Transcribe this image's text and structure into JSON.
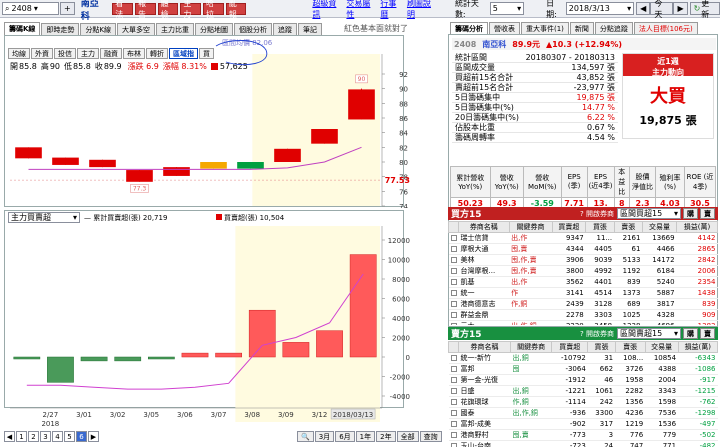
{
  "topbar": {
    "stock_code": "2408",
    "stock_name": "南亞科",
    "quick_buttons": [
      "看法",
      "報告",
      "體檢",
      "主力",
      "哈拉",
      "亂報"
    ],
    "links": [
      "超級資訊",
      "交易屬性",
      "行事曆",
      "刷圖說明"
    ],
    "days_label": "統計天數:",
    "days_value": "5",
    "date_label": "日期:",
    "date_value": "2018/3/13",
    "today_btn": "今天",
    "refresh_btn": "更新"
  },
  "main_tabs": [
    "籌碼K線",
    "即時走勢",
    "分點K線",
    "大單多空",
    "主力比重",
    "分點地圖",
    "個股分析",
    "追蹤",
    "筆記"
  ],
  "main_tab_active": 0,
  "slogan": "紅色基本面就對了",
  "sub_tabs": [
    "均線",
    "外資",
    "投信",
    "主力",
    "融資",
    "布林",
    "轉折",
    "區域指",
    "買"
  ],
  "sub_tab_active": 7,
  "annotation_text": "區間均價 82.06",
  "pricebar": {
    "open_label": "開",
    "open": "85.8",
    "high_label": "高",
    "high": "90",
    "low_label": "低",
    "low": "85.8",
    "close_label": "收",
    "close": "89.9",
    "chg": "漲跌 6.9",
    "pct": "漲幅 8.31%",
    "vol": "57,625"
  },
  "price_axis": [
    "92",
    "90",
    "88",
    "86",
    "84",
    "82",
    "80",
    "78",
    "76",
    "74"
  ],
  "price_last": "77.53",
  "high_tag": "90",
  "low_tag": "77.3",
  "candles": [
    {
      "open": 82.0,
      "close": 80.5,
      "high": 82.0,
      "low": 80.5,
      "color": "#e00000"
    },
    {
      "open": 80.6,
      "close": 79.6,
      "high": 80.6,
      "low": 79.6,
      "color": "#e00000"
    },
    {
      "open": 80.3,
      "close": 79.3,
      "high": 80.3,
      "low": 79.3,
      "color": "#e00000"
    },
    {
      "open": 78.9,
      "close": 77.3,
      "high": 78.9,
      "low": 77.3,
      "color": "#e00000"
    },
    {
      "open": 79.3,
      "close": 78.1,
      "high": 79.3,
      "low": 78.1,
      "color": "#e00000"
    },
    {
      "open": 79.1,
      "close": 80.0,
      "high": 80.0,
      "low": 79.1,
      "color": "#f5a800"
    },
    {
      "open": 80.0,
      "close": 79.1,
      "high": 80.0,
      "low": 79.1,
      "color": "#00a040"
    },
    {
      "open": 81.8,
      "close": 80.0,
      "high": 81.8,
      "low": 80.0,
      "color": "#e00000"
    },
    {
      "open": 84.5,
      "close": 82.5,
      "high": 84.5,
      "low": 82.5,
      "color": "#e00000"
    },
    {
      "open": 85.8,
      "close": 89.9,
      "high": 90.0,
      "low": 85.8,
      "color": "#e00000"
    }
  ],
  "avg_line": [
    79.0,
    79.0,
    79.0,
    79.0,
    79.0,
    79.0,
    79.0,
    79.2,
    80.0,
    82.0
  ],
  "lower": {
    "select_label": "主力買賣超",
    "legend_line": "— 累計買賣超(張) 20,719",
    "legend_bar": "買賣超(張) 10,504",
    "axis": [
      "12000",
      "10000",
      "8000",
      "6000",
      "4000",
      "2000",
      "0",
      "-2000",
      "-4000"
    ]
  },
  "vol_bars": [
    -120,
    -2600,
    -400,
    -400,
    -150,
    400,
    400,
    4800,
    1500,
    2700,
    10504
  ],
  "cum_line": [
    -2900,
    -2900,
    -3100,
    -3300,
    -3300,
    -3100,
    -2700,
    1200,
    2000,
    3500,
    8500
  ],
  "x_labels": [
    "2/27",
    "3/01",
    "3/02",
    "3/05",
    "3/06",
    "3/07",
    "3/08",
    "3/09",
    "3/12",
    "2018/03/13"
  ],
  "x_year": "2018",
  "bottom": {
    "pages": [
      "1",
      "2",
      "3",
      "4",
      "5",
      "6"
    ],
    "page_active": 5,
    "ranges": [
      "3月",
      "6月",
      "1年",
      "2年",
      "全部",
      "查詢"
    ]
  },
  "right_tabs": [
    "籌碼分析",
    "營收表",
    "重大事件(1)",
    "新聞",
    "分點追蹤",
    "法人目標(106元)"
  ],
  "right_tab_active": 0,
  "quote": {
    "code": "2408",
    "name": "南亞科",
    "price": "89.9元",
    "chg": "▲10.3 (+12.94%)"
  },
  "stats": [
    {
      "label": "統計區間",
      "value": "20180307 - 20180313",
      "color": "#000"
    },
    {
      "label": "區間成交量",
      "value": "134,597 張",
      "color": "#000"
    },
    {
      "label": "買超前15名合計",
      "value": "43,852 張",
      "color": "#000"
    },
    {
      "label": "賣超前15名合計",
      "value": "-23,977 張",
      "color": "#000"
    },
    {
      "label": "5日籌碼集中",
      "value": "19,875 張",
      "color": "#e00000"
    },
    {
      "label": "5日籌碼集中(%)",
      "value": "14.77 %",
      "color": "#e00000"
    },
    {
      "label": "20日籌碼集中(%)",
      "value": "6.22 %",
      "color": "#e00000"
    },
    {
      "label": "佔股本比重",
      "value": "0.67 %",
      "color": "#000"
    },
    {
      "label": "籌碼周轉率",
      "value": "4.54 %",
      "color": "#000"
    }
  ],
  "signal": {
    "head1": "近1週",
    "head2": "主力動向",
    "big": "大買",
    "value": "19,875 張"
  },
  "fundamentals": {
    "headers": [
      "累計營收 YoY(%)",
      "營收 YoY(%)",
      "營收 MoM(%)",
      "EPS (季)",
      "EPS (近4季)",
      "本益比",
      "股價 淨值比",
      "殖利率 (%)",
      "ROE (近4季)"
    ],
    "values": [
      "50.23",
      "49.3",
      "-3.59",
      "7.71",
      "13.",
      "8",
      "2.3",
      "4.03",
      "30.5"
    ]
  },
  "buy": {
    "title": "買方15",
    "link": "開啟券商",
    "select": "區間買超15",
    "btn1": "購",
    "btn2": "賣",
    "headers": [
      "券商名稱",
      "關鍵券商",
      "買賣超",
      "買張",
      "賣張",
      "交易量",
      "損益(萬)"
    ],
    "rows": [
      [
        "瑞士信貸",
        "出,作",
        "9347",
        "11...",
        "2161",
        "13669",
        "4142"
      ],
      [
        "摩根大通",
        "囤,賣",
        "4344",
        "4405",
        "61",
        "4466",
        "2865"
      ],
      [
        "美林",
        "囤,作,賣",
        "3906",
        "9039",
        "5133",
        "14172",
        "2842"
      ],
      [
        "台灣摩根...",
        "囤,作,賣",
        "3800",
        "4992",
        "1192",
        "6184",
        "2006"
      ],
      [
        "凱基",
        "出,作",
        "3562",
        "4401",
        "839",
        "5240",
        "2354"
      ],
      [
        "統一",
        "作",
        "3141",
        "4514",
        "1373",
        "5887",
        "1438"
      ],
      [
        "港商德意志",
        "作,銅",
        "2439",
        "3128",
        "689",
        "3817",
        "839"
      ],
      [
        "群益金鼎",
        "",
        "2278",
        "3303",
        "1025",
        "4328",
        "909"
      ],
      [
        "元大",
        "出,作,銅",
        "2220",
        "3458",
        "1238",
        "4696",
        "1383"
      ]
    ]
  },
  "sell": {
    "title": "賣方15",
    "link": "開啟券商",
    "select": "區間賣超15",
    "btn1": "購",
    "btn2": "賣",
    "headers": [
      "券商名稱",
      "關鍵券商",
      "買賣超",
      "買張",
      "賣張",
      "交易量",
      "損益(萬)"
    ],
    "rows": [
      [
        "統一-新竹",
        "出,銅",
        "-10792",
        "31",
        "108...",
        "10854",
        "-6343"
      ],
      [
        "富邦",
        "囤",
        "-3064",
        "662",
        "3726",
        "4388",
        "-1086"
      ],
      [
        "第一金-光復",
        "",
        "-1912",
        "46",
        "1958",
        "2004",
        "-917"
      ],
      [
        "日盛",
        "出,銅",
        "-1221",
        "1061",
        "2282",
        "3343",
        "-1215"
      ],
      [
        "花旗環球",
        "作,銅",
        "-1114",
        "242",
        "1356",
        "1598",
        "-762"
      ],
      [
        "國泰",
        "出,作,銅",
        "-936",
        "3300",
        "4236",
        "7536",
        "-1298"
      ],
      [
        "富邦-成美",
        "",
        "-902",
        "317",
        "1219",
        "1536",
        "-497"
      ],
      [
        "港商野村",
        "囤,賣",
        "-773",
        "3",
        "776",
        "779",
        "-502"
      ],
      [
        "玉山-台南",
        "",
        "-723",
        "24",
        "747",
        "771",
        "-482"
      ]
    ]
  }
}
